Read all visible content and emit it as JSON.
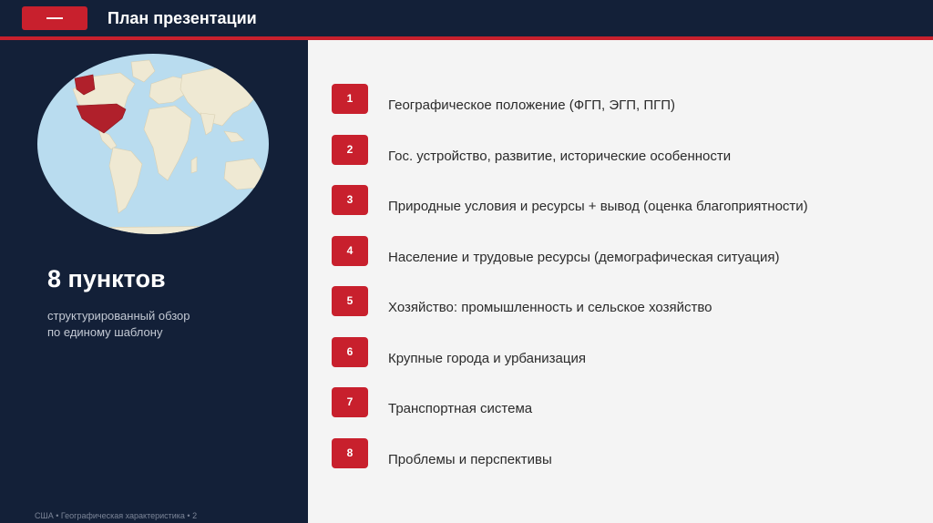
{
  "header": {
    "badge": "—",
    "title": "План презентации"
  },
  "summary": {
    "count_title": "8 пунктов",
    "subtitle_line1": "структурированный обзор",
    "subtitle_line2": "по единому шаблону"
  },
  "map": {
    "icon": "world-map-icon",
    "highlight_color": "#b0202b",
    "ocean_color": "#b9dcef",
    "land_color": "#efe9d3"
  },
  "items": [
    {
      "num": "1",
      "label": "Географическое положение (ФГП, ЭГП, ПГП)"
    },
    {
      "num": "2",
      "label": "Гос. устройство, развитие, исторические особенности"
    },
    {
      "num": "3",
      "label": "Природные условия и ресурсы + вывод (оценка благоприятности)"
    },
    {
      "num": "4",
      "label": "Население и трудовые ресурсы (демографическая ситуация)"
    },
    {
      "num": "5",
      "label": "Хозяйство: промышленность и сельское хозяйство"
    },
    {
      "num": "6",
      "label": "Крупные города и урбанизация"
    },
    {
      "num": "7",
      "label": "Транспортная система"
    },
    {
      "num": "8",
      "label": "Проблемы и перспективы"
    }
  ],
  "footer": {
    "text": "США • Географическая характеристика • 2"
  },
  "colors": {
    "navy": "#132038",
    "accent_red": "#c8202d",
    "panel_light": "#f4f4f4"
  }
}
